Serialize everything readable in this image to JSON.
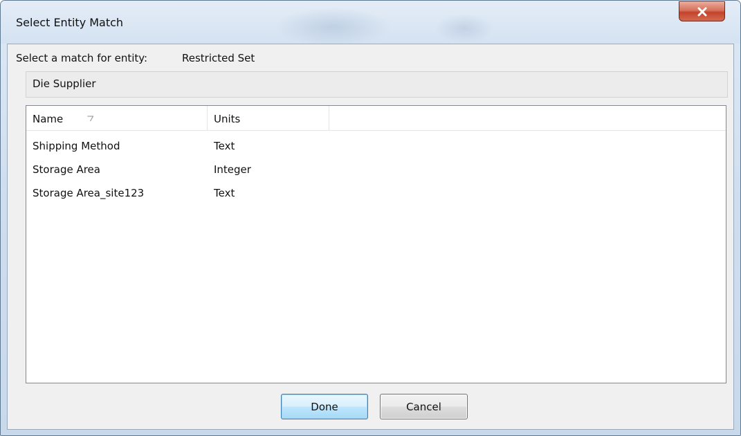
{
  "window": {
    "title": "Select Entity Match"
  },
  "prompt": {
    "label": "Select a match for entity:",
    "value": "Restricted Set"
  },
  "entity": {
    "name": "Die Supplier"
  },
  "table": {
    "columns": [
      {
        "label": "Name",
        "sorted": true
      },
      {
        "label": "Units"
      }
    ],
    "rows": [
      {
        "name": "Shipping Method",
        "units": "Text"
      },
      {
        "name": "Storage Area",
        "units": "Integer"
      },
      {
        "name": "Storage Area_site123",
        "units": "Text"
      }
    ]
  },
  "buttons": {
    "done": "Done",
    "cancel": "Cancel"
  },
  "icons": {
    "close": "close-icon",
    "sort": "sort-indicator-icon"
  },
  "colors": {
    "close_button": "#c7452f",
    "default_button_border": "#3c7fb1"
  }
}
